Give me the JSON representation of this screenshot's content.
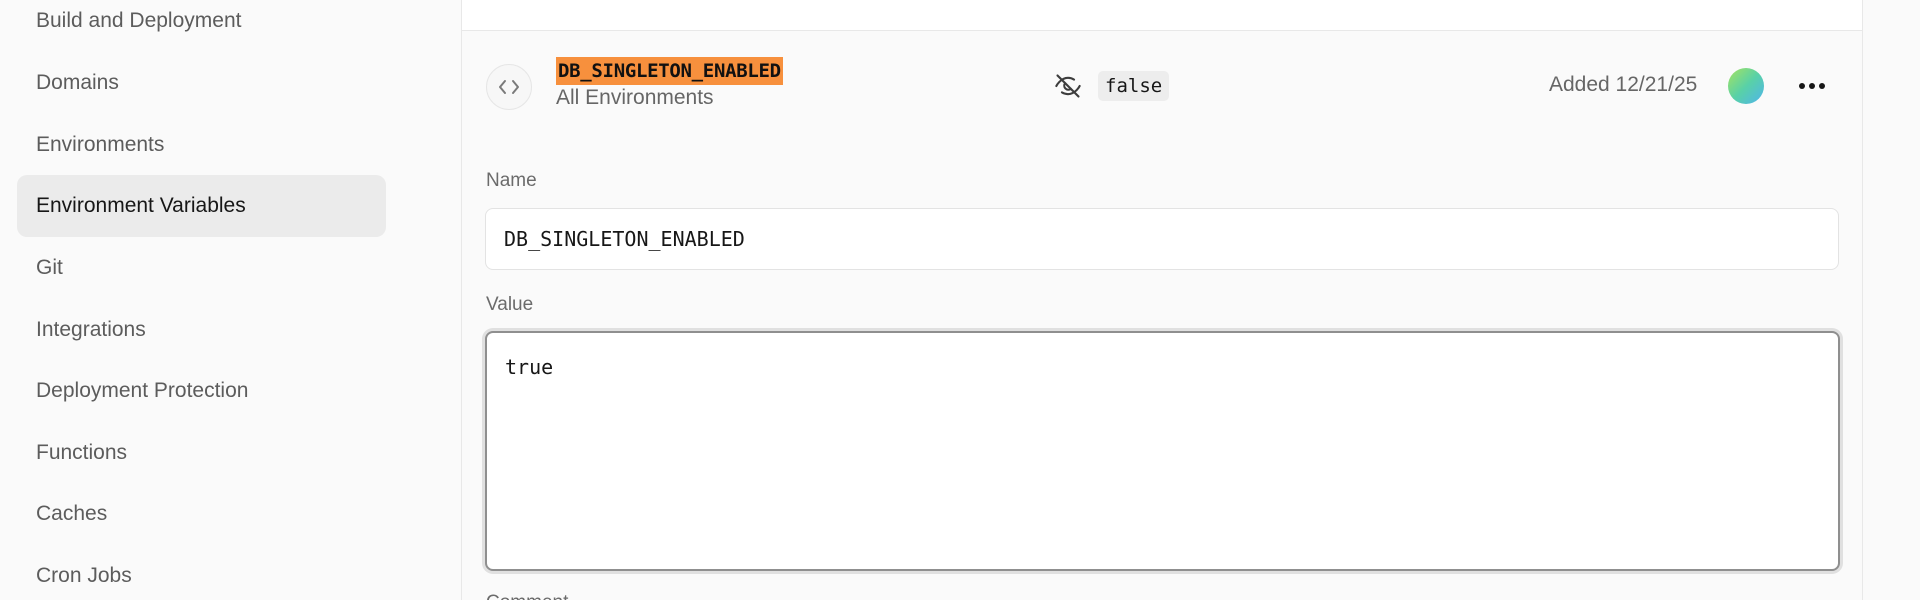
{
  "sidebar": {
    "items": [
      {
        "label": "Build and Deployment"
      },
      {
        "label": "Domains"
      },
      {
        "label": "Environments"
      },
      {
        "label": "Environment Variables",
        "active": true
      },
      {
        "label": "Git"
      },
      {
        "label": "Integrations"
      },
      {
        "label": "Deployment Protection"
      },
      {
        "label": "Functions"
      },
      {
        "label": "Caches"
      },
      {
        "label": "Cron Jobs"
      }
    ]
  },
  "variable": {
    "code_icon": "code-brackets-icon",
    "name_badge": "DB_SINGLETON_ENABLED",
    "scope": "All Environments",
    "hidden_icon": "eye-off-icon",
    "current_value": "false",
    "added": "Added 12/21/25",
    "more_icon": "more-horizontal-icon"
  },
  "form": {
    "name_label": "Name",
    "name_value": "DB_SINGLETON_ENABLED",
    "value_label": "Value",
    "value_value": "true",
    "comment_label": "Comment"
  },
  "colors": {
    "highlight": "#f7903d",
    "active_nav_bg": "#ebebeb"
  }
}
